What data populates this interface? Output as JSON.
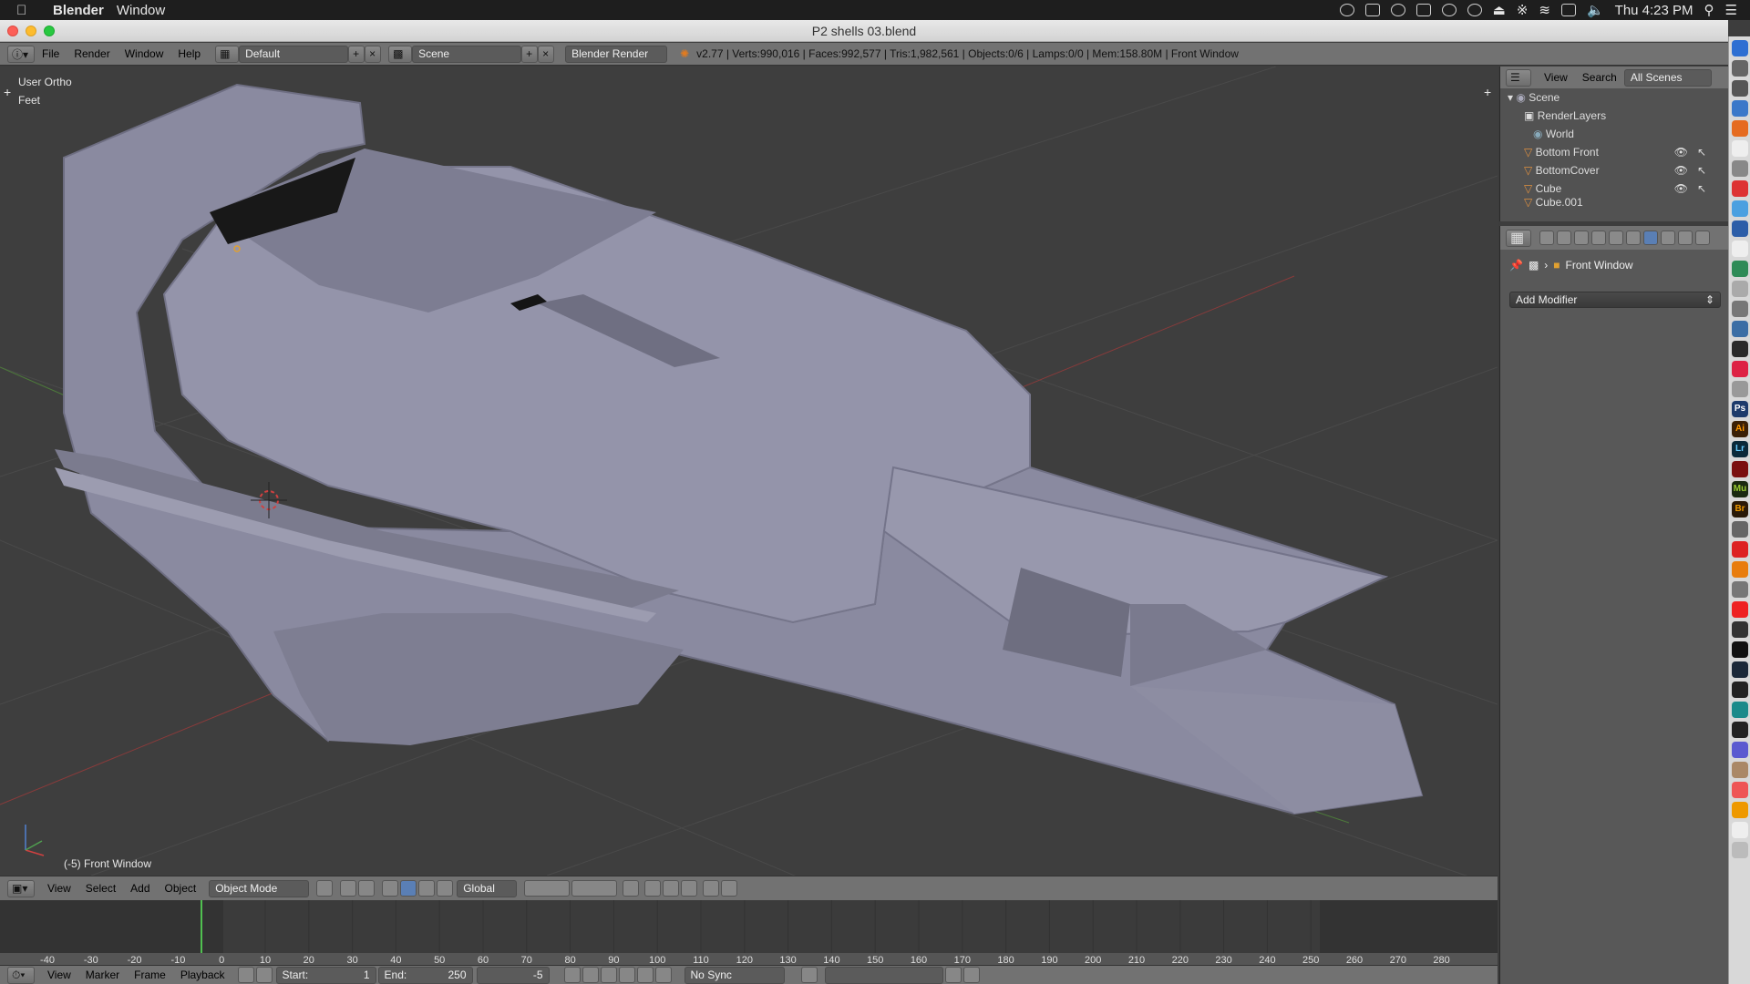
{
  "menubar": {
    "app": "Blender",
    "menu": "Window",
    "clock": "Thu 4:23 PM"
  },
  "window": {
    "title": "P2 shells 03.blend"
  },
  "info_header": {
    "menus": [
      "File",
      "Render",
      "Window",
      "Help"
    ],
    "layout": "Default",
    "scene": "Scene",
    "engine": "Blender Render",
    "stats": "v2.77 | Verts:990,016 | Faces:992,577 | Tris:1,982,561 | Objects:0/6 | Lamps:0/0 | Mem:158.80M | Front Window"
  },
  "viewport": {
    "view_name": "User Ortho",
    "units": "Feet",
    "object_label": "(-5) Front Window"
  },
  "outliner": {
    "tabs": [
      "View",
      "Search"
    ],
    "filter": "All Scenes",
    "items": [
      {
        "label": "Scene",
        "icon": "scene-icon"
      },
      {
        "label": "RenderLayers",
        "icon": "render-layers-icon"
      },
      {
        "label": "World",
        "icon": "world-icon"
      },
      {
        "label": "Bottom Front",
        "icon": "mesh-icon"
      },
      {
        "label": "BottomCover",
        "icon": "mesh-icon"
      },
      {
        "label": "Cube",
        "icon": "mesh-icon"
      },
      {
        "label": "Cube.001",
        "icon": "mesh-icon"
      }
    ]
  },
  "properties": {
    "object_name": "Front Window",
    "add_modifier": "Add Modifier"
  },
  "view3d_header": {
    "menus": [
      "View",
      "Select",
      "Add",
      "Object"
    ],
    "mode": "Object Mode",
    "orientation": "Global"
  },
  "timeline": {
    "ticks": [
      "-40",
      "-30",
      "-20",
      "-10",
      "0",
      "10",
      "20",
      "30",
      "40",
      "50",
      "60",
      "70",
      "80",
      "90",
      "100",
      "110",
      "120",
      "130",
      "140",
      "150",
      "160",
      "170",
      "180",
      "190",
      "200",
      "210",
      "220",
      "230",
      "240",
      "250",
      "260",
      "270",
      "280"
    ],
    "menus": [
      "View",
      "Marker",
      "Frame",
      "Playback"
    ],
    "start_label": "Start:",
    "start": "1",
    "end_label": "End:",
    "end": "250",
    "current": "-5",
    "sync": "No Sync"
  },
  "colors": {
    "accent": "#5a7fb5",
    "header": "#727272",
    "viewport": "#3e3e3e",
    "mesh": "#8a8aa0"
  }
}
